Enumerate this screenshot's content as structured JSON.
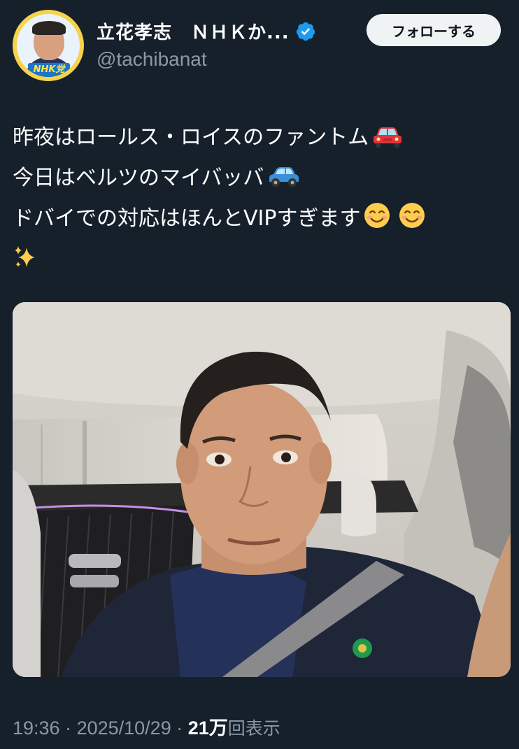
{
  "author": {
    "display_name": "立花孝志　ＮＨＫか...",
    "handle": "@tachibanat",
    "avatar_badge": "NHK党",
    "verified": true
  },
  "follow_button": {
    "label": "フォローする"
  },
  "tweet": {
    "lines": [
      {
        "text": "昨夜はロールス・ロイスのファントム",
        "emoji": "red-car"
      },
      {
        "text": "今日はベルツのマイバッバ",
        "emoji": "blue-car"
      },
      {
        "text": "ドバイでの対応はほんとVIPすぎます",
        "emoji": "smiling-face x2"
      },
      {
        "text": "",
        "emoji": "sparkles"
      }
    ],
    "media": {
      "type": "photo",
      "description_icon": "selfie-photo"
    }
  },
  "meta": {
    "time": "19:36",
    "separator": " · ",
    "date": "2025/10/29",
    "views_count": "21万",
    "views_label": "回表示"
  },
  "colors": {
    "background": "#15202b",
    "secondary_text": "#8b98a5",
    "verified_blue": "#1d9bf0",
    "button_bg": "#eff3f4"
  }
}
